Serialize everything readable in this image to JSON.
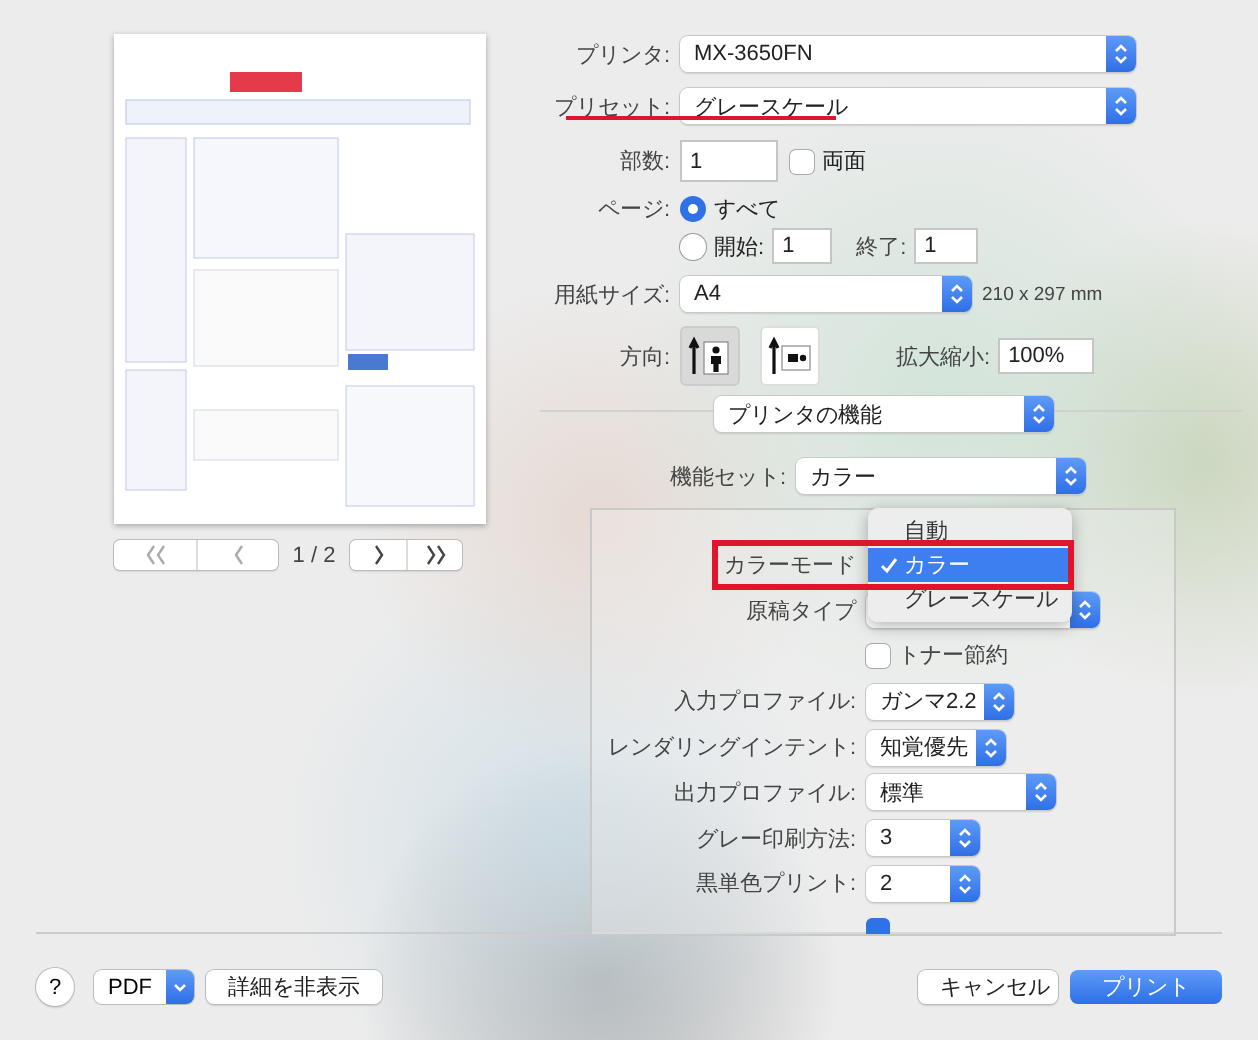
{
  "preview": {
    "page_indicator": "1 / 2"
  },
  "printer": {
    "label": "プリンタ:",
    "value": "MX-3650FN"
  },
  "preset": {
    "label": "プリセット:",
    "value": "グレースケール",
    "underlined": true
  },
  "copies": {
    "label": "部数:",
    "value": "1"
  },
  "duplex": {
    "label": "両面",
    "checked": false
  },
  "pages": {
    "label": "ページ:",
    "options": [
      {
        "label": "すべて",
        "selected": true
      },
      {
        "label": "開始:",
        "selected": false
      }
    ],
    "from": "1",
    "to_label": "終了:",
    "to": "1"
  },
  "paper_size": {
    "label": "用紙サイズ:",
    "value": "A4",
    "dimensions": "210 x 297 mm"
  },
  "orientation": {
    "label": "方向:",
    "options": [
      {
        "kind": "portrait",
        "selected": true
      },
      {
        "kind": "landscape",
        "selected": false
      }
    ]
  },
  "scale": {
    "label": "拡大縮小:",
    "value": "100%"
  },
  "section": {
    "value": "プリンタの機能"
  },
  "feature_set": {
    "label": "機能セット:",
    "value": "カラー"
  },
  "settings": [
    {
      "kind": "popup",
      "label": "カラーモード",
      "outlined": true
    },
    {
      "kind": "popup",
      "label": "原稿タイプ"
    },
    {
      "kind": "checkbox",
      "label": "トナー節約",
      "checked": false
    },
    {
      "kind": "popup",
      "label": "入力プロファイル:",
      "value": "ガンマ2.2"
    },
    {
      "kind": "popup",
      "label": "レンダリングインテント:",
      "value": "知覚優先"
    },
    {
      "kind": "popup",
      "label": "出力プロファイル:",
      "value": "標準"
    },
    {
      "kind": "popup",
      "label": "グレー印刷方法:",
      "value": "3"
    },
    {
      "kind": "popup",
      "label": "黒単色プリント:",
      "value": "2"
    },
    {
      "kind": "checkbox",
      "checked": true
    }
  ],
  "menu": {
    "items": [
      {
        "label": "自動",
        "selected": false
      },
      {
        "label": "カラー",
        "selected": true
      },
      {
        "label": "グレースケール",
        "selected": false
      }
    ]
  },
  "footer": {
    "help": "?",
    "pdf": "PDF",
    "details": "詳細を非表示",
    "cancel": "キャンセル",
    "print": "プリント"
  }
}
